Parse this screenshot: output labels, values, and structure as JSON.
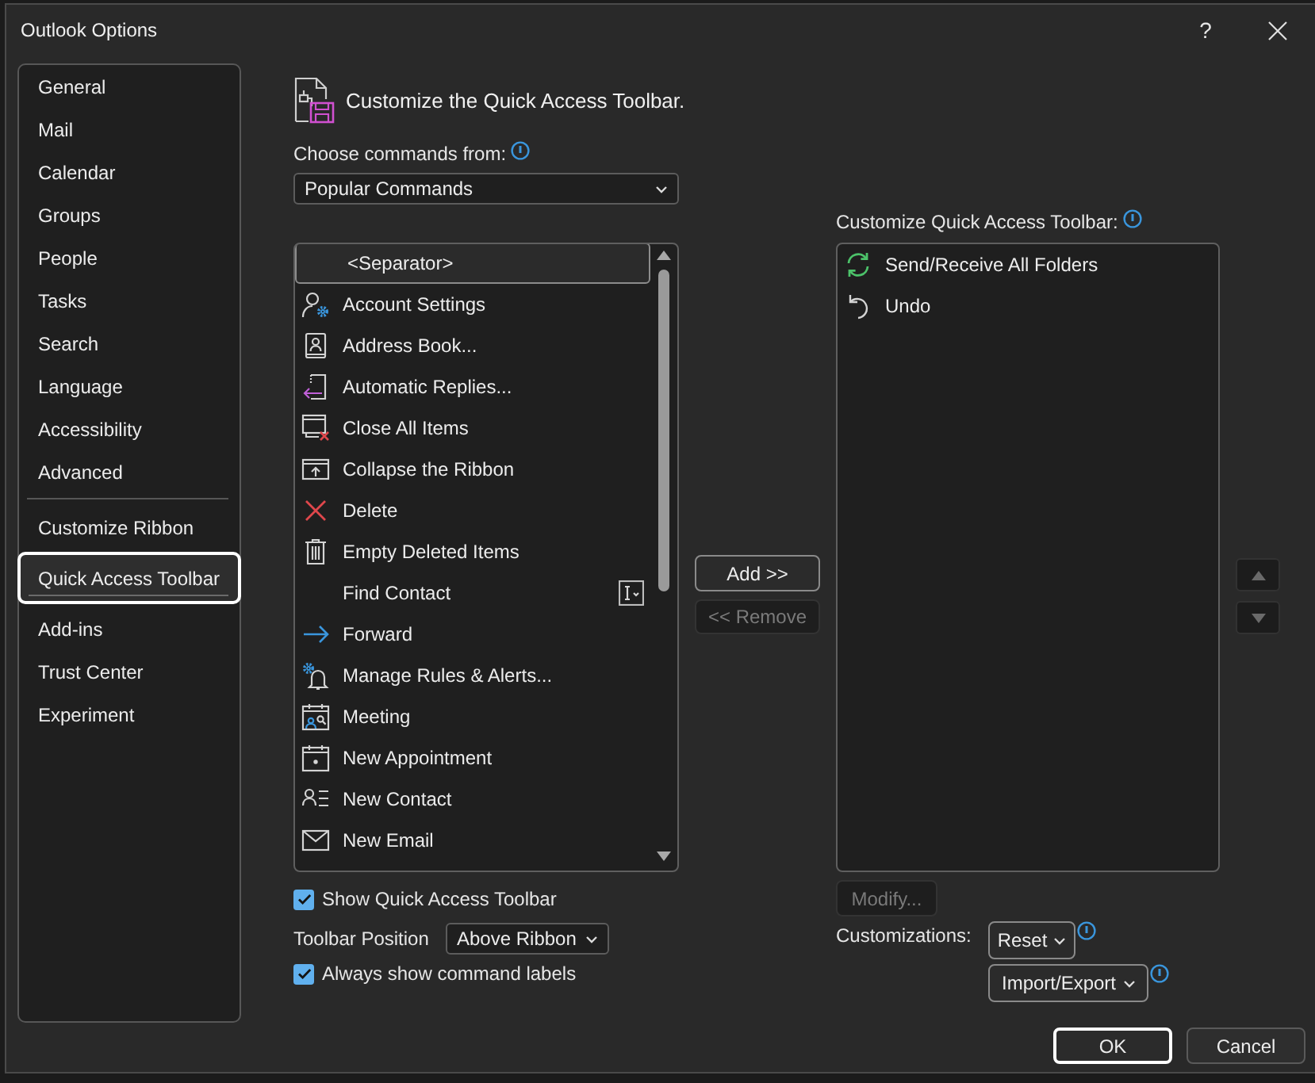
{
  "window": {
    "title": "Outlook Options",
    "help": "?"
  },
  "sidebar": {
    "groups": [
      {
        "items": [
          {
            "label": "General",
            "selected": false
          },
          {
            "label": "Mail",
            "selected": false
          },
          {
            "label": "Calendar",
            "selected": false
          },
          {
            "label": "Groups",
            "selected": false
          },
          {
            "label": "People",
            "selected": false
          },
          {
            "label": "Tasks",
            "selected": false
          },
          {
            "label": "Search",
            "selected": false
          },
          {
            "label": "Language",
            "selected": false
          },
          {
            "label": "Accessibility",
            "selected": false
          },
          {
            "label": "Advanced",
            "selected": false
          }
        ]
      },
      {
        "items": [
          {
            "label": "Customize Ribbon",
            "selected": false
          },
          {
            "label": "Quick Access Toolbar",
            "selected": true
          },
          {
            "label": "Add-ins",
            "selected": false
          },
          {
            "label": "Trust Center",
            "selected": false
          },
          {
            "label": "Experiment",
            "selected": false
          }
        ]
      }
    ]
  },
  "header": {
    "title": "Customize the Quick Access Toolbar."
  },
  "commands_from": {
    "label": "Choose commands from:",
    "value": "Popular Commands"
  },
  "commands": [
    {
      "label": "<Separator>",
      "kind": "separator",
      "selected": true
    },
    {
      "label": "Account Settings",
      "kind": "command",
      "selected": false
    },
    {
      "label": "Address Book...",
      "kind": "command",
      "selected": false
    },
    {
      "label": "Automatic Replies...",
      "kind": "command",
      "selected": false
    },
    {
      "label": "Close All Items",
      "kind": "command",
      "selected": false
    },
    {
      "label": "Collapse the Ribbon",
      "kind": "command",
      "selected": false
    },
    {
      "label": "Delete",
      "kind": "command",
      "selected": false
    },
    {
      "label": "Empty Deleted Items",
      "kind": "command",
      "selected": false
    },
    {
      "label": "Find Contact",
      "kind": "field",
      "selected": false
    },
    {
      "label": "Forward",
      "kind": "command",
      "selected": false
    },
    {
      "label": "Manage Rules & Alerts...",
      "kind": "command",
      "selected": false
    },
    {
      "label": "Meeting",
      "kind": "command",
      "selected": false
    },
    {
      "label": "New Appointment",
      "kind": "command",
      "selected": false
    },
    {
      "label": "New Contact",
      "kind": "command",
      "selected": false
    },
    {
      "label": "New Email",
      "kind": "command",
      "selected": false
    }
  ],
  "add_button": {
    "label": "Add >>",
    "disabled": false
  },
  "remove_button": {
    "label": "<< Remove",
    "disabled": true
  },
  "toolbar": {
    "label": "Customize Quick Access Toolbar:",
    "items": [
      {
        "label": "Send/Receive All Folders",
        "selected": false
      },
      {
        "label": "Undo",
        "selected": false
      }
    ]
  },
  "move_up_button": {
    "disabled": true
  },
  "move_down_button": {
    "disabled": true
  },
  "modify_button": {
    "label": "Modify...",
    "disabled": true
  },
  "customizations": {
    "label": "Customizations:",
    "reset_button": "Reset",
    "import_export_button": "Import/Export"
  },
  "show_toolbar": {
    "label": "Show Quick Access Toolbar",
    "checked": true
  },
  "toolbar_position": {
    "label": "Toolbar Position",
    "value": "Above Ribbon"
  },
  "show_labels": {
    "label": "Always show command labels",
    "checked": true
  },
  "buttons": [
    {
      "label": "OK",
      "default": true
    },
    {
      "label": "Cancel",
      "default": false
    }
  ]
}
